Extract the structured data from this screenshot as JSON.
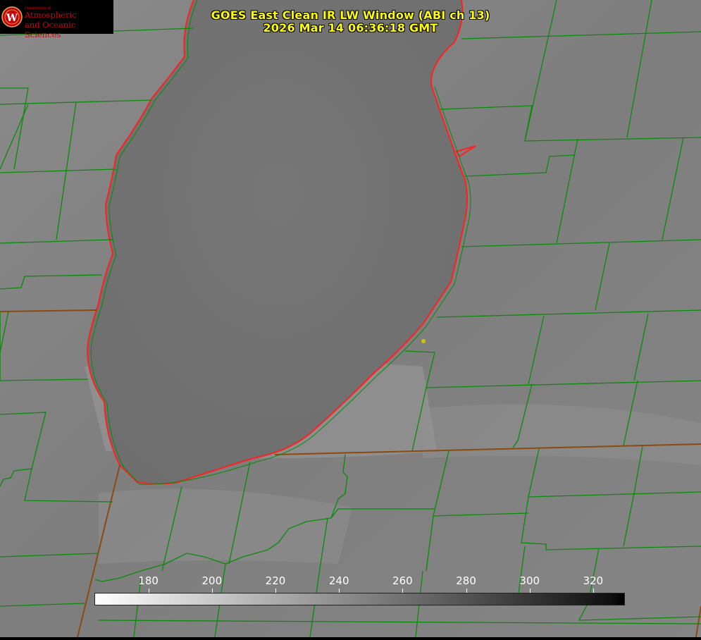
{
  "title": {
    "line1": "GOES East Clean IR LW Window (ABI ch 13)",
    "line2": "2026 Mar 14 06:36:18 GMT"
  },
  "logo": {
    "department": "Department of",
    "line1": "Atmospheric",
    "line2": "and Oceanic Sciences",
    "seal_letter": "W"
  },
  "colorbar": {
    "ticks": [
      "180",
      "200",
      "220",
      "240",
      "260",
      "280",
      "300",
      "320"
    ],
    "min": 163,
    "max": 330,
    "color_low": "#ffffff",
    "color_high": "#000000"
  },
  "colors": {
    "county_lines": "#0a8a0a",
    "state_lines": "#8a4a10",
    "lake_outline": "#ff2020",
    "title_text": "#ffff00",
    "marker": "#d4c400"
  }
}
